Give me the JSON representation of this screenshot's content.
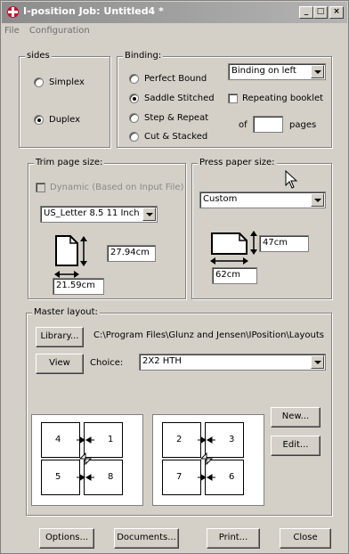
{
  "window": {
    "title": "I-position Job: Untitled4 *",
    "controls": {
      "minimize": "_",
      "maximize": "□",
      "close": "×"
    }
  },
  "menu": {
    "items": [
      "File",
      "Configuration"
    ]
  },
  "sides": {
    "legend": "sides",
    "simplex": "Simplex",
    "duplex": "Duplex",
    "selected": "duplex"
  },
  "binding": {
    "legend": "Binding:",
    "options": [
      "Perfect Bound",
      "Saddle Stitched",
      "Step & Repeat",
      "Cut & Stacked"
    ],
    "selected": "Saddle Stitched",
    "position_select": "Binding on left",
    "repeating_label": "Repeating booklet",
    "of_label": "of",
    "pages_value": "",
    "pages_label": "pages"
  },
  "trim": {
    "legend": "Trim page size:",
    "dynamic_label": "Dynamic (Based on Input File)",
    "size_select": "US_Letter 8.5 11 Inch",
    "height": "27.94cm",
    "width": "21.59cm"
  },
  "press": {
    "legend": "Press paper size:",
    "size_select": "Custom",
    "height": "47cm",
    "width": "62cm"
  },
  "master": {
    "legend": "Master layout:",
    "library_button": "Library...",
    "library_path": "C:\\Program Files\\Glunz and Jensen\\IPosition\\Layouts",
    "view_button": "View",
    "choice_label": "Choice:",
    "choice_value": "2X2 HTH",
    "new_button": "New...",
    "edit_button": "Edit...",
    "sheets": [
      {
        "cells": [
          "4",
          "1",
          "5",
          "8"
        ]
      },
      {
        "cells": [
          "2",
          "3",
          "7",
          "6"
        ]
      }
    ]
  },
  "footer": {
    "options": "Options...",
    "documents": "Documents...",
    "print": "Print...",
    "close": "Close"
  }
}
